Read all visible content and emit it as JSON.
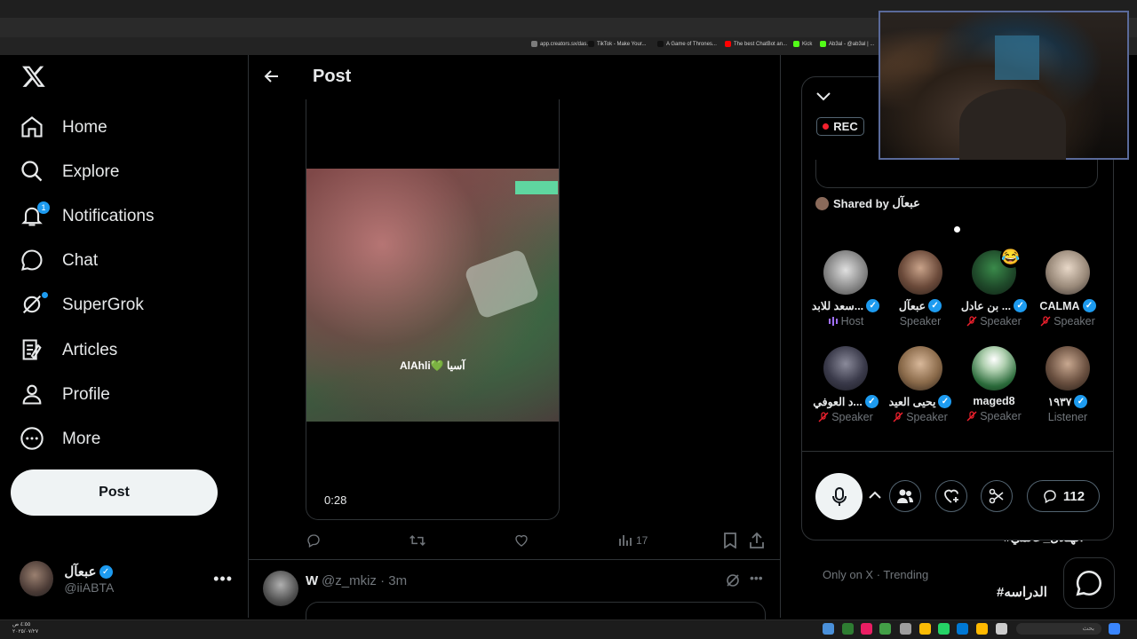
{
  "browser": {
    "bookmarks": [
      {
        "label": "app.creators.sx/das...",
        "color": "#7c7c7c"
      },
      {
        "label": "TikTok - Make Your...",
        "color": "#111111"
      },
      {
        "label": "A Game of Thrones...",
        "color": "#111111"
      },
      {
        "label": "The best ChatBot an...",
        "color": "#ff0000"
      },
      {
        "label": "Kick",
        "color": "#53fc18"
      },
      {
        "label": "Ab3al - @ab3al | ...",
        "color": "#53fc18"
      }
    ]
  },
  "nav": {
    "items": [
      {
        "label": "Home",
        "icon": "home-icon"
      },
      {
        "label": "Explore",
        "icon": "search-icon"
      },
      {
        "label": "Notifications",
        "icon": "bell-icon",
        "badge": "1"
      },
      {
        "label": "Chat",
        "icon": "chat-icon"
      },
      {
        "label": "SuperGrok",
        "icon": "grok-icon"
      },
      {
        "label": "Articles",
        "icon": "articles-icon"
      },
      {
        "label": "Profile",
        "icon": "person-icon"
      },
      {
        "label": "More",
        "icon": "more-icon"
      }
    ],
    "post_button": "Post"
  },
  "account": {
    "name": "عبعآل",
    "handle": "@iiABTA"
  },
  "post": {
    "header_title": "Post",
    "video_caption": "AlAhli💚 آسيا",
    "video_duration": "0:28",
    "views": "17"
  },
  "reply": {
    "name": "W",
    "handle_time": "@z_mkiz · 3m"
  },
  "sidebar": {
    "partial_trend": "#الهـلال_عالمي",
    "only_on_x": "Only on X · Trending",
    "trend_1": "#الدراسه"
  },
  "space": {
    "rec_label": "REC",
    "shared_by_label": "Shared by",
    "shared_by_name": "عبعآل",
    "participants": [
      {
        "name": "سعد للابد...",
        "role": "Host",
        "verified": true,
        "role_icon": "host-bars-icon"
      },
      {
        "name": "عبعآل",
        "role": "Speaker",
        "verified": true,
        "role_icon": ""
      },
      {
        "name": "بن عادل ...",
        "role": "Speaker",
        "verified": true,
        "role_icon": "mic-muted-icon",
        "emoji": "😂"
      },
      {
        "name": "CALMA",
        "role": "Speaker",
        "verified": true,
        "role_icon": "mic-muted-icon"
      },
      {
        "name": "د العوفي...",
        "role": "Speaker",
        "verified": true,
        "role_icon": "mic-muted-icon"
      },
      {
        "name": "يحيى العيد",
        "role": "Speaker",
        "verified": true,
        "role_icon": "mic-muted-icon"
      },
      {
        "name": "maged8",
        "role": "Speaker",
        "verified": false,
        "role_icon": "mic-muted-icon"
      },
      {
        "name": "١٩٣٧",
        "role": "Listener",
        "verified": true,
        "role_icon": ""
      }
    ],
    "comment_count": "112"
  },
  "taskbar": {
    "clock_time": "٤:٥٥ ص",
    "clock_date": "٢٠٢٥/٠٧/٢٧",
    "search_placeholder": "بحث"
  },
  "colors": {
    "accent": "#1d9bf0",
    "muted": "#71767b",
    "host_purple": "#a070ff",
    "muted_red": "#f4212e"
  }
}
